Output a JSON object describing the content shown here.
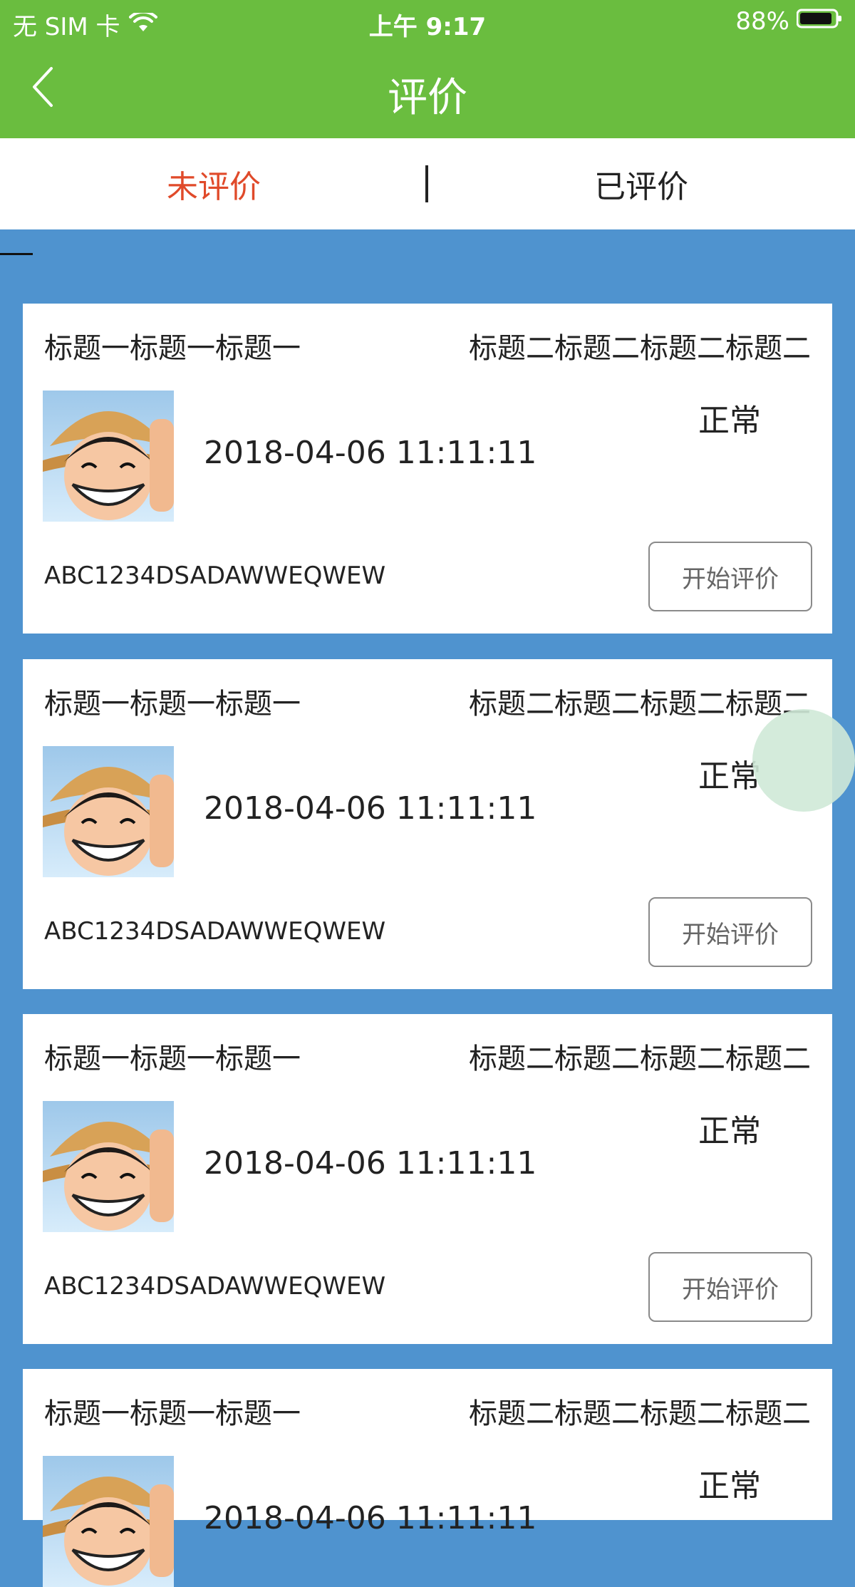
{
  "status_bar": {
    "carrier": "无 SIM 卡",
    "time": "上午 9:17",
    "battery": "88%"
  },
  "nav": {
    "title": "评价"
  },
  "tabs": [
    {
      "label": "未评价",
      "active": true
    },
    {
      "label": "已评价",
      "active": false
    }
  ],
  "cards": [
    {
      "title_left": "标题一标题一标题一",
      "title_right": "标题二标题二标题二标题二",
      "status": "正常",
      "date": "2018-04-06 11:11:11",
      "code": "ABC1234DSADAWWEQWEW",
      "button": "开始评价"
    },
    {
      "title_left": "标题一标题一标题一",
      "title_right": "标题二标题二标题二标题二",
      "status": "正常",
      "date": "2018-04-06 11:11:11",
      "code": "ABC1234DSADAWWEQWEW",
      "button": "开始评价"
    },
    {
      "title_left": "标题一标题一标题一",
      "title_right": "标题二标题二标题二标题二",
      "status": "正常",
      "date": "2018-04-06 11:11:11",
      "code": "ABC1234DSADAWWEQWEW",
      "button": "开始评价"
    },
    {
      "title_left": "标题一标题一标题一",
      "title_right": "标题二标题二标题二标题二",
      "status": "正常",
      "date": "2018-04-06 11:11:11",
      "code": "",
      "button": ""
    }
  ],
  "colors": {
    "nav_green": "#6abd3f",
    "list_bg": "#4f93cf",
    "active_tab": "#e04a2a"
  },
  "icons": [
    "wifi-icon",
    "battery-icon",
    "back-chevron-icon",
    "avatar-image"
  ]
}
